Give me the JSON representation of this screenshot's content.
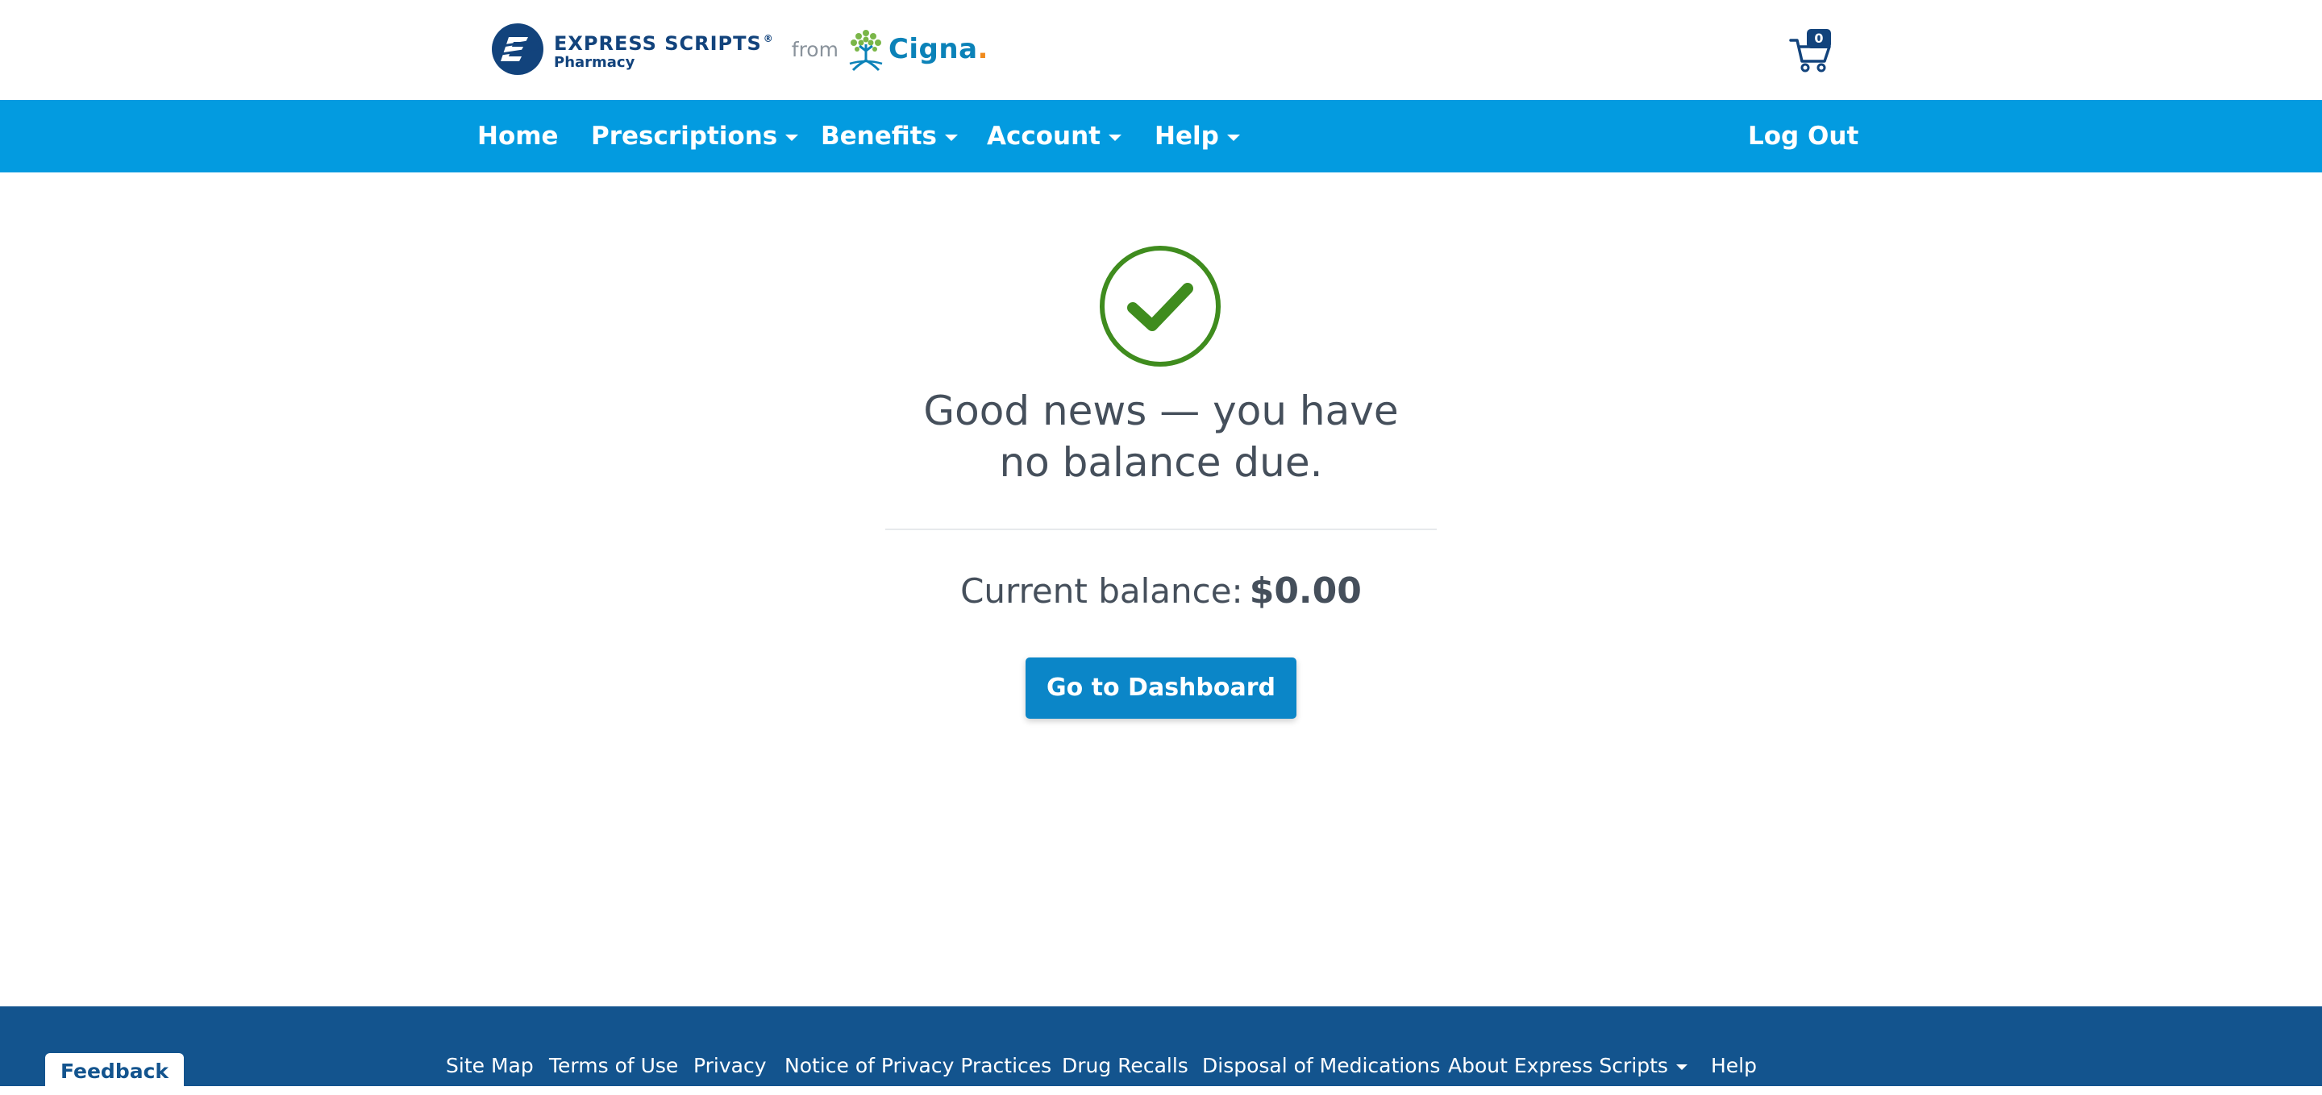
{
  "header": {
    "brand_name": "EXPRESS SCRIPTS",
    "brand_sub": "Pharmacy",
    "from_text": "from",
    "partner_name": "Cigna",
    "cart_count": "0",
    "brand_color": "#12437c"
  },
  "nav": {
    "items": [
      {
        "label": "Home",
        "has_menu": false
      },
      {
        "label": "Prescriptions",
        "has_menu": true
      },
      {
        "label": "Benefits",
        "has_menu": true
      },
      {
        "label": "Account",
        "has_menu": true
      },
      {
        "label": "Help",
        "has_menu": true
      }
    ],
    "logout_label": "Log Out",
    "background": "#039be0"
  },
  "main": {
    "status_icon": "check-circle-icon",
    "status_color": "#3f8c1e",
    "headline_line1": "Good news — you have",
    "headline_line2": "no balance due.",
    "balance_label": "Current balance:",
    "balance_value": "$0.00",
    "dashboard_button": "Go to Dashboard"
  },
  "footer": {
    "links": [
      {
        "label": "Site Map"
      },
      {
        "label": "Terms of Use"
      },
      {
        "label": "Privacy"
      },
      {
        "label": "Notice of Privacy Practices"
      },
      {
        "label": "Drug Recalls"
      },
      {
        "label": "Disposal of Medications"
      },
      {
        "label": "About Express Scripts",
        "has_menu": true
      },
      {
        "label": "Help"
      }
    ],
    "feedback_label": "Feedback",
    "background": "#13548e"
  }
}
